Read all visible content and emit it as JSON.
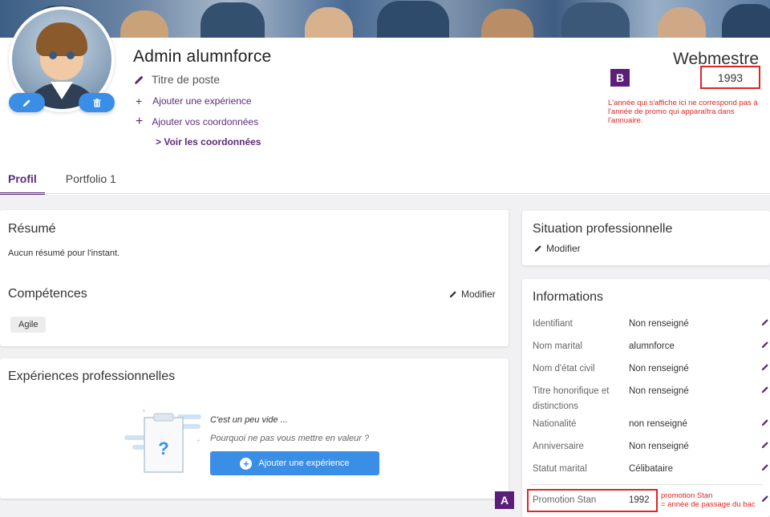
{
  "colors": {
    "brand": "#5b2b7a",
    "primary_button": "#3a8ee6",
    "annotation_red": "#e02424",
    "badge": "#5b1f7a"
  },
  "profile": {
    "name": "Admin alumnforce",
    "job_title": "Titre de poste",
    "add_experience": "Ajouter une expérience",
    "add_contact": "Ajouter vos coordonnées",
    "view_contact": "> Voir les coordonnées",
    "role": "Webmestre",
    "promo_year": "1993",
    "avatar_edit_icon": "pencil-icon",
    "avatar_delete_icon": "trash-icon"
  },
  "annotations": {
    "a": "A",
    "b": "B",
    "b_note": "L'année qui s'affiche ici ne correspond pas à l'année de promo qui apparaîtra dans l'annuaire.",
    "a_note_line1": "promotion Stan",
    "a_note_line2": "= année de passage du bac"
  },
  "tabs": [
    {
      "label": "Profil",
      "active": true
    },
    {
      "label": "Portfolio 1",
      "active": false
    }
  ],
  "resume": {
    "title": "Résumé",
    "empty": "Aucun résumé pour l'instant."
  },
  "skills": {
    "title": "Compétences",
    "edit": "Modifier",
    "tags": [
      "Agile"
    ]
  },
  "experiences": {
    "title": "Expériences professionnelles",
    "empty_line1": "C'est un peu vide ...",
    "empty_line2": "Pourquoi ne pas vous mettre en valeur ?",
    "add_button": "Ajouter une expérience"
  },
  "situation": {
    "title": "Situation professionnelle",
    "edit": "Modifier"
  },
  "informations": {
    "title": "Informations",
    "rows": [
      {
        "label": "Identifiant",
        "value": "Non renseigné"
      },
      {
        "label": "Nom marital",
        "value": "alumnforce"
      },
      {
        "label": "Nom d'état civil",
        "value": "Non renseigné"
      },
      {
        "label": "Titre honorifique et distinctions",
        "value": "Non renseigné"
      },
      {
        "label": "Nationalité",
        "value": "non renseigné"
      },
      {
        "label": "Anniversaire",
        "value": "Non renseigné"
      },
      {
        "label": "Statut marital",
        "value": "Célibataire"
      },
      {
        "label": "Promotion Stan",
        "value": "1992"
      }
    ]
  }
}
